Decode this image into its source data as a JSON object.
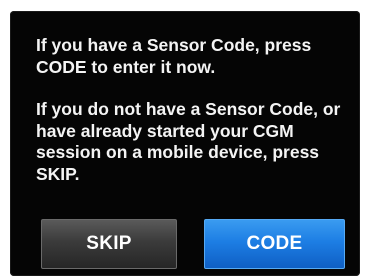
{
  "message": {
    "line1": "If you have a Sensor Code, press CODE to enter it now.",
    "line2": "If you do not have a Sensor Code, or have already started your CGM session on a mobile device, press SKIP."
  },
  "buttons": {
    "skip_label": "SKIP",
    "code_label": "CODE"
  },
  "colors": {
    "screen_background": "#050505",
    "text": "#f4f4f4",
    "skip_button": "#3b3b3b",
    "code_button": "#1d7ee4"
  }
}
